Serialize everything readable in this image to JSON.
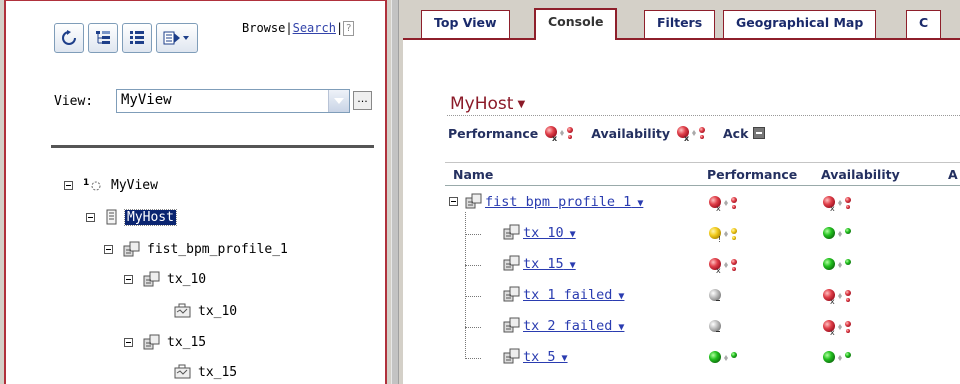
{
  "toolbar": {
    "refresh_icon": "refresh-icon",
    "tree_icon": "tree-view-icon",
    "list_icon": "list-view-icon",
    "menu_icon": "context-menu-icon"
  },
  "browse": {
    "browse_label": "Browse",
    "separator": "|",
    "search_label": "Search",
    "help": "?"
  },
  "view": {
    "label": "View:",
    "value": "MyView",
    "more": "..."
  },
  "tree": {
    "root": "MyView",
    "host": "MyHost",
    "profile": "fist_bpm_profile_1",
    "tx10": "tx_10",
    "tx10_child": "tx_10",
    "tx15": "tx_15",
    "tx15_child": "tx_15"
  },
  "tabs": [
    "Top View",
    "Console",
    "Filters",
    "Geographical Map",
    "C"
  ],
  "active_tab": "Console",
  "console": {
    "host": "MyHost",
    "legend_performance": "Performance",
    "legend_availability": "Availability",
    "legend_ack": "Ack",
    "col_name": "Name",
    "col_performance": "Performance",
    "col_availability": "Availability",
    "col_more": "A",
    "rows": [
      {
        "name": "fist bpm profile 1",
        "performance": "critical",
        "availability": "critical"
      },
      {
        "name": "tx 10",
        "performance": "warning",
        "availability": "ok"
      },
      {
        "name": "tx 15",
        "performance": "critical",
        "availability": "ok"
      },
      {
        "name": "tx 1 failed",
        "performance": "no-data",
        "availability": "critical"
      },
      {
        "name": "tx 2 failed",
        "performance": "no-data",
        "availability": "critical"
      },
      {
        "name": "tx 5",
        "performance": "ok",
        "availability": "ok"
      }
    ]
  },
  "colors": {
    "border_red": "#b0313c",
    "critical": "#e0404a",
    "warning": "#f2cc1e",
    "ok": "#22c01e",
    "no_data": "#b5b5b5",
    "link": "#2a3cb0"
  }
}
